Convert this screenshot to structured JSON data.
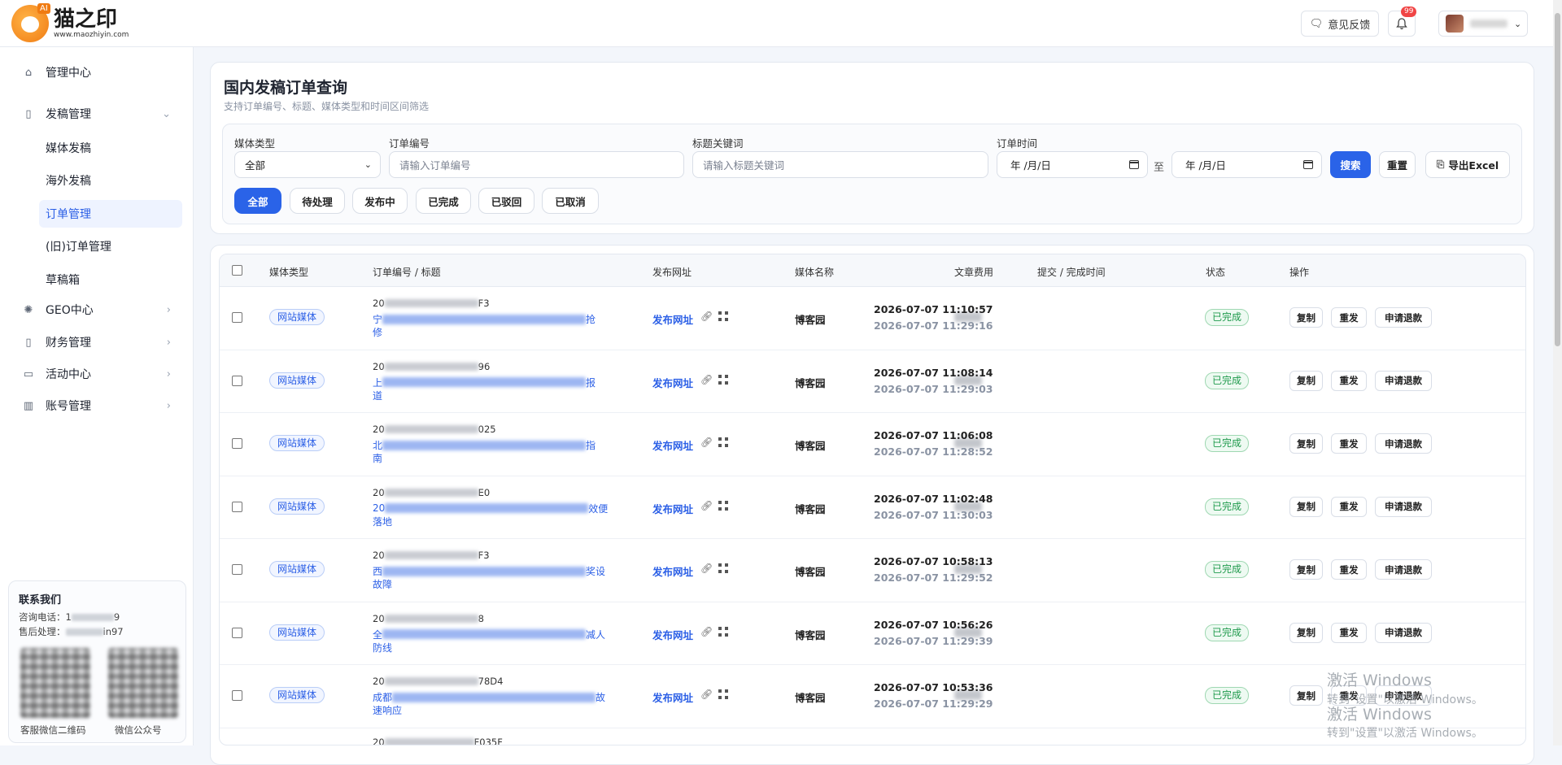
{
  "header": {
    "logo_title": "猫之印",
    "logo_sub": "www.maozhiyin.com",
    "logo_badge": "AI",
    "feedback_label": "意见反馈",
    "notification_count": "99"
  },
  "sidebar": {
    "items": [
      {
        "label": "管理中心",
        "icon": "home-icon"
      },
      {
        "label": "发稿管理",
        "icon": "document-icon"
      },
      {
        "label": "GEO中心",
        "icon": "geo-icon"
      },
      {
        "label": "财务管理",
        "icon": "finance-icon"
      },
      {
        "label": "活动中心",
        "icon": "activity-icon"
      },
      {
        "label": "账号管理",
        "icon": "account-icon"
      }
    ],
    "sub_items": [
      "媒体发稿",
      "海外发稿",
      "订单管理",
      "(旧)订单管理",
      "草稿箱"
    ],
    "contact": {
      "title": "联系我们",
      "phone_label": "咨询电话：",
      "phone_prefix": "1",
      "phone_suffix": "9",
      "aftersales_label": "售后处理：",
      "aftersales_suffix": "in97",
      "qr1_label": "客服微信二维码",
      "qr2_label": "微信公众号"
    }
  },
  "page": {
    "title": "国内发稿订单查询",
    "subtitle": "支持订单编号、标题、媒体类型和时间区间筛选"
  },
  "filters": {
    "media_type_label": "媒体类型",
    "media_type_value": "全部",
    "order_no_label": "订单编号",
    "order_no_placeholder": "请输入订单编号",
    "keyword_label": "标题关键词",
    "keyword_placeholder": "请输入标题关键词",
    "time_label": "订单时间",
    "date_placeholder": "年 /月/日",
    "to_label": "至",
    "search_label": "搜索",
    "reset_label": "重置",
    "export_label": "导出Excel",
    "status_tabs": [
      "全部",
      "待处理",
      "发布中",
      "已完成",
      "已驳回",
      "已取消"
    ]
  },
  "table": {
    "columns": [
      "媒体类型",
      "订单编号 / 标题",
      "发布网址",
      "媒体名称",
      "文章费用",
      "提交 / 完成时间",
      "状态",
      "操作"
    ],
    "rows": [
      {
        "media_type": "网站媒体",
        "order_prefix": "20",
        "order_suffix": "F3",
        "title_start": "宁",
        "title_end": "抢",
        "title_line2": "修",
        "link_label": "发布网址",
        "media_name": "博客园",
        "submit_time": "2026-07-07 11:10:57",
        "complete_time": "2026-07-07 11:29:16",
        "status": "已完成"
      },
      {
        "media_type": "网站媒体",
        "order_prefix": "20",
        "order_suffix": "96",
        "title_start": "上",
        "title_end": "报",
        "title_line2": "道",
        "link_label": "发布网址",
        "media_name": "博客园",
        "submit_time": "2026-07-07 11:08:14",
        "complete_time": "2026-07-07 11:29:03",
        "status": "已完成"
      },
      {
        "media_type": "网站媒体",
        "order_prefix": "20",
        "order_suffix": "025",
        "title_start": "北",
        "title_end": "指",
        "title_line2": "南",
        "link_label": "发布网址",
        "media_name": "博客园",
        "submit_time": "2026-07-07 11:06:08",
        "complete_time": "2026-07-07 11:28:52",
        "status": "已完成"
      },
      {
        "media_type": "网站媒体",
        "order_prefix": "20",
        "order_suffix": "E0",
        "title_start": "20",
        "title_end": "效便",
        "title_line2": "落地",
        "link_label": "发布网址",
        "media_name": "博客园",
        "submit_time": "2026-07-07 11:02:48",
        "complete_time": "2026-07-07 11:30:03",
        "status": "已完成"
      },
      {
        "media_type": "网站媒体",
        "order_prefix": "20",
        "order_suffix": "F3",
        "title_start": "西",
        "title_end": "奖设",
        "title_line2": "故障",
        "link_label": "发布网址",
        "media_name": "博客园",
        "submit_time": "2026-07-07 10:58:13",
        "complete_time": "2026-07-07 11:29:52",
        "status": "已完成"
      },
      {
        "media_type": "网站媒体",
        "order_prefix": "20",
        "order_suffix": "8",
        "title_start": "全",
        "title_end": "减人",
        "title_line2": "防线",
        "link_label": "发布网址",
        "media_name": "博客园",
        "submit_time": "2026-07-07 10:56:26",
        "complete_time": "2026-07-07 11:29:39",
        "status": "已完成"
      },
      {
        "media_type": "网站媒体",
        "order_prefix": "20",
        "order_suffix": "78D4",
        "title_start": "成都",
        "title_end": "故",
        "title_line2": "速响应",
        "link_label": "发布网址",
        "media_name": "博客园",
        "submit_time": "2026-07-07 10:53:36",
        "complete_time": "2026-07-07 11:29:29",
        "status": "已完成"
      }
    ],
    "partial_row": {
      "order_prefix": "20",
      "order_suffix": "F035F"
    },
    "actions": [
      "复制",
      "重发",
      "申请退款"
    ]
  },
  "watermark": {
    "line1": "激活 Windows",
    "line2": "转到\"设置\"以激活 Windows。"
  }
}
